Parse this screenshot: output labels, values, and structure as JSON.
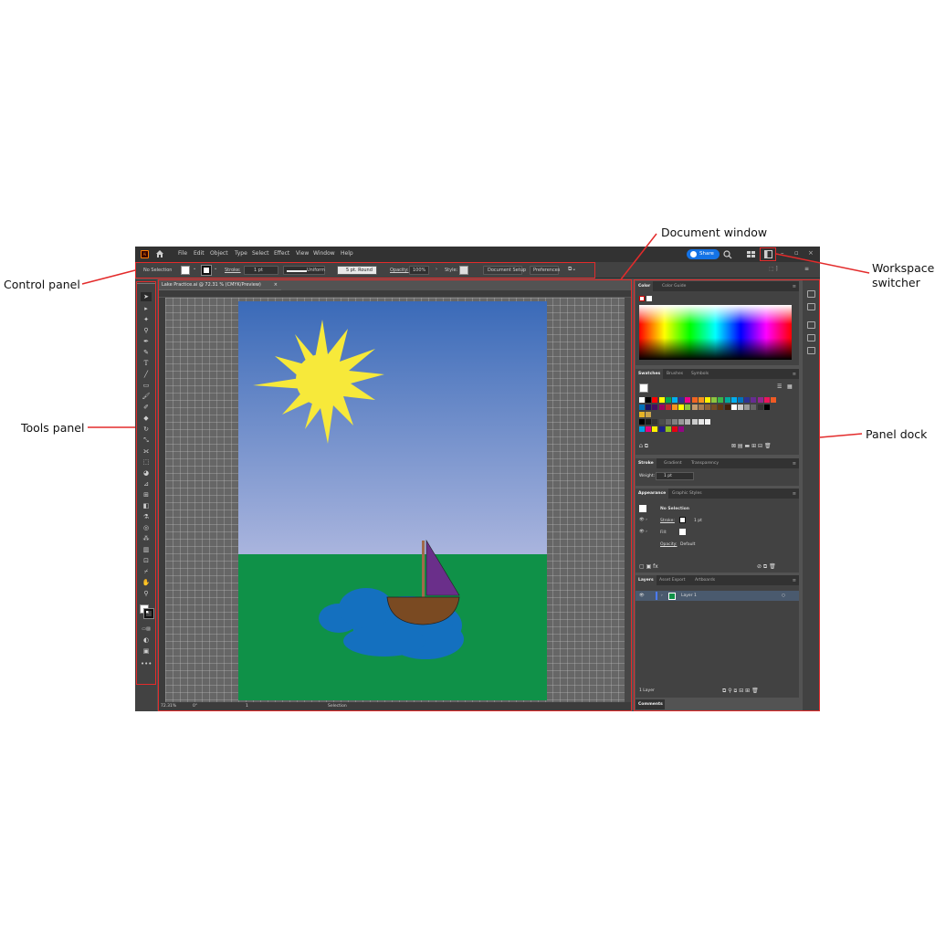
{
  "callouts": {
    "document_window": "Document window",
    "control_panel": "Control panel",
    "workspace_switcher": "Workspace switcher",
    "tools_panel": "Tools panel",
    "panel_dock": "Panel dock"
  },
  "menubar": {
    "logo": "Ai",
    "items": [
      "File",
      "Edit",
      "Object",
      "Type",
      "Select",
      "Effect",
      "View",
      "Window",
      "Help"
    ],
    "share_label": "Share"
  },
  "controlbar": {
    "selection": "No Selection",
    "stroke_label": "Stroke:",
    "stroke_value": "1 pt",
    "profile": "Uniform",
    "brush": "5 pt. Round",
    "opacity_label": "Opacity:",
    "opacity_value": "100%",
    "style_label": "Style:",
    "document_setup": "Document Setup",
    "preferences": "Preferences"
  },
  "document": {
    "tab_title": "Lake Practice.ai @ 72.31 % (CMYK/Preview)",
    "zoom": "72.31%",
    "rotation": "0°",
    "artboard_nav": "1",
    "status_tool": "Selection"
  },
  "color_panel": {
    "tabs": [
      "Color",
      "Color Guide"
    ]
  },
  "swatches_panel": {
    "tabs": [
      "Swatches",
      "Brushes",
      "Symbols"
    ]
  },
  "stroke_panel": {
    "tabs": [
      "Stroke",
      "Gradient",
      "Transparency"
    ],
    "weight_label": "Weight:",
    "weight_value": "1 pt"
  },
  "appearance_panel": {
    "tabs": [
      "Appearance",
      "Graphic Styles"
    ],
    "title": "No Selection",
    "stroke_label": "Stroke:",
    "stroke_value": "1 pt",
    "fill_label": "Fill:",
    "opacity_label": "Opacity:",
    "opacity_value": "Default"
  },
  "layers_panel": {
    "tabs": [
      "Layers",
      "Asset Export",
      "Artboards"
    ],
    "layer_name": "Layer 1",
    "footer": "1 Layer"
  },
  "comments_tab": "Comments",
  "colors": {
    "accent": "#e32b2b",
    "share": "#1473e6",
    "sky_top": "#3a6ab8",
    "sky_bottom": "#aab5de",
    "grass": "#0f9148",
    "lake": "#1470bf",
    "sun": "#f7e93a",
    "boat": "#7a4a22",
    "sail": "#6a2f8a"
  }
}
